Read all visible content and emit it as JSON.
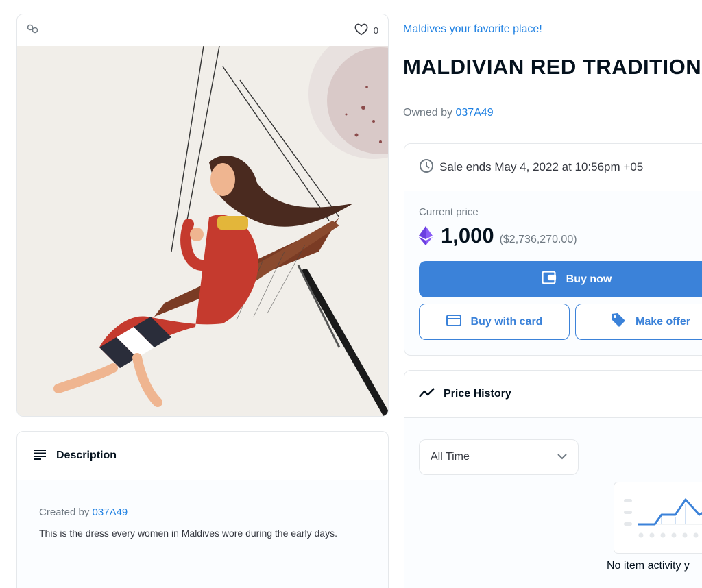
{
  "media": {
    "favorite_count": "0",
    "image_alt": "Watercolor of woman in red traditional dress on a swing"
  },
  "description": {
    "title": "Description",
    "created_by_label": "Created by",
    "creator": "037A49",
    "text": "This is the dress every women in Maldives wore during the early days."
  },
  "item": {
    "collection": "Maldives your favorite place!",
    "title": "MALDIVIAN RED TRADITIONA",
    "owned_by_label": "Owned by",
    "owner": "037A49"
  },
  "sale": {
    "ends_text": "Sale ends May 4, 2022 at 10:56pm +05",
    "current_price_label": "Current price",
    "price": "1,000",
    "price_usd": "($2,736,270.00)",
    "buy_now_label": "Buy now",
    "buy_card_label": "Buy with card",
    "make_offer_label": "Make offer"
  },
  "history": {
    "title": "Price History",
    "range_selected": "All Time",
    "empty_text": "No item activity y"
  },
  "colors": {
    "accent": "#2081e2",
    "button": "#3b82d9",
    "eth": "#8a5cf6"
  }
}
